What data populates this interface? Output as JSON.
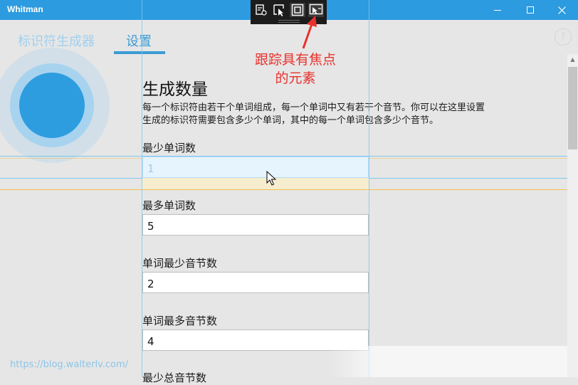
{
  "window": {
    "title": "Whitman",
    "controls": [
      "minimize-icon",
      "maximize-icon",
      "close-icon"
    ]
  },
  "devtools_toolbar": {
    "tools": [
      "live-visual-tree-icon",
      "select-element-icon",
      "display-layout-adorners-icon",
      "track-focused-element-icon"
    ]
  },
  "nav": {
    "tabs": [
      {
        "label": "标识符生成器"
      },
      {
        "label": "设置",
        "selected": true
      }
    ],
    "accent": "#3a9bd5"
  },
  "annotation": {
    "line1": "跟踪具有焦点",
    "line2": "的元素",
    "color": "#e8322d"
  },
  "settings": {
    "section_title": "生成数量",
    "description_line1": "每一个标识符由若干个单词组成，每一个单词中又有若干个音节。你可以在这里设置",
    "description_line2": "生成的标识符需要包含多少个单词，其中的每一个单词包含多少个音节。",
    "fields": [
      {
        "label": "最少单词数",
        "value": "1",
        "focused": true
      },
      {
        "label": "最多单词数",
        "value": "5"
      },
      {
        "label": "单词最少音节数",
        "value": "2"
      },
      {
        "label": "单词最多音节数",
        "value": "4"
      },
      {
        "label": "最少总音节数"
      }
    ]
  },
  "help": {
    "label": "?"
  },
  "watermark": "https://blog.walterlv.com/"
}
